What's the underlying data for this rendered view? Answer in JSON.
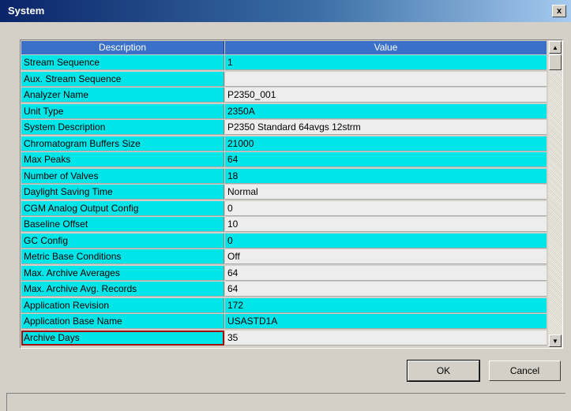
{
  "window": {
    "title": "System",
    "close_label": "x"
  },
  "table": {
    "columns": [
      "Description",
      "Value"
    ],
    "rows": [
      {
        "desc": "Stream Sequence",
        "value": "1",
        "hl": true
      },
      {
        "desc": "Aux. Stream Sequence",
        "value": "",
        "hl": false
      },
      {
        "desc": "Analyzer Name",
        "value": "P2350_001",
        "hl": false
      },
      {
        "desc": "Unit Type",
        "value": "2350A",
        "hl": true
      },
      {
        "desc": "System Description",
        "value": "P2350 Standard 64avgs 12strm",
        "hl": false
      },
      {
        "desc": "Chromatogram Buffers Size",
        "value": "21000",
        "hl": true
      },
      {
        "desc": "Max Peaks",
        "value": "64",
        "hl": true
      },
      {
        "desc": "Number of Valves",
        "value": "18",
        "hl": true
      },
      {
        "desc": "Daylight Saving Time",
        "value": "Normal",
        "hl": false
      },
      {
        "desc": "CGM Analog Output Config",
        "value": "0",
        "hl": false
      },
      {
        "desc": "Baseline Offset",
        "value": "10",
        "hl": false
      },
      {
        "desc": "GC Config",
        "value": "0",
        "hl": true
      },
      {
        "desc": "Metric Base Conditions",
        "value": "Off",
        "hl": false
      },
      {
        "desc": "Max. Archive Averages",
        "value": "64",
        "hl": false
      },
      {
        "desc": "Max. Archive Avg. Records",
        "value": "64",
        "hl": false
      },
      {
        "desc": "Application Revision",
        "value": "172",
        "hl": true
      },
      {
        "desc": "Application Base Name",
        "value": "USASTD1A",
        "hl": true
      },
      {
        "desc": "Archive Days",
        "value": "35",
        "hl": false,
        "selected": true
      }
    ]
  },
  "buttons": {
    "ok": "OK",
    "cancel": "Cancel"
  },
  "colors": {
    "highlight": "#00e5e8",
    "header": "#3a70c8",
    "selection_border": "#a01010"
  }
}
